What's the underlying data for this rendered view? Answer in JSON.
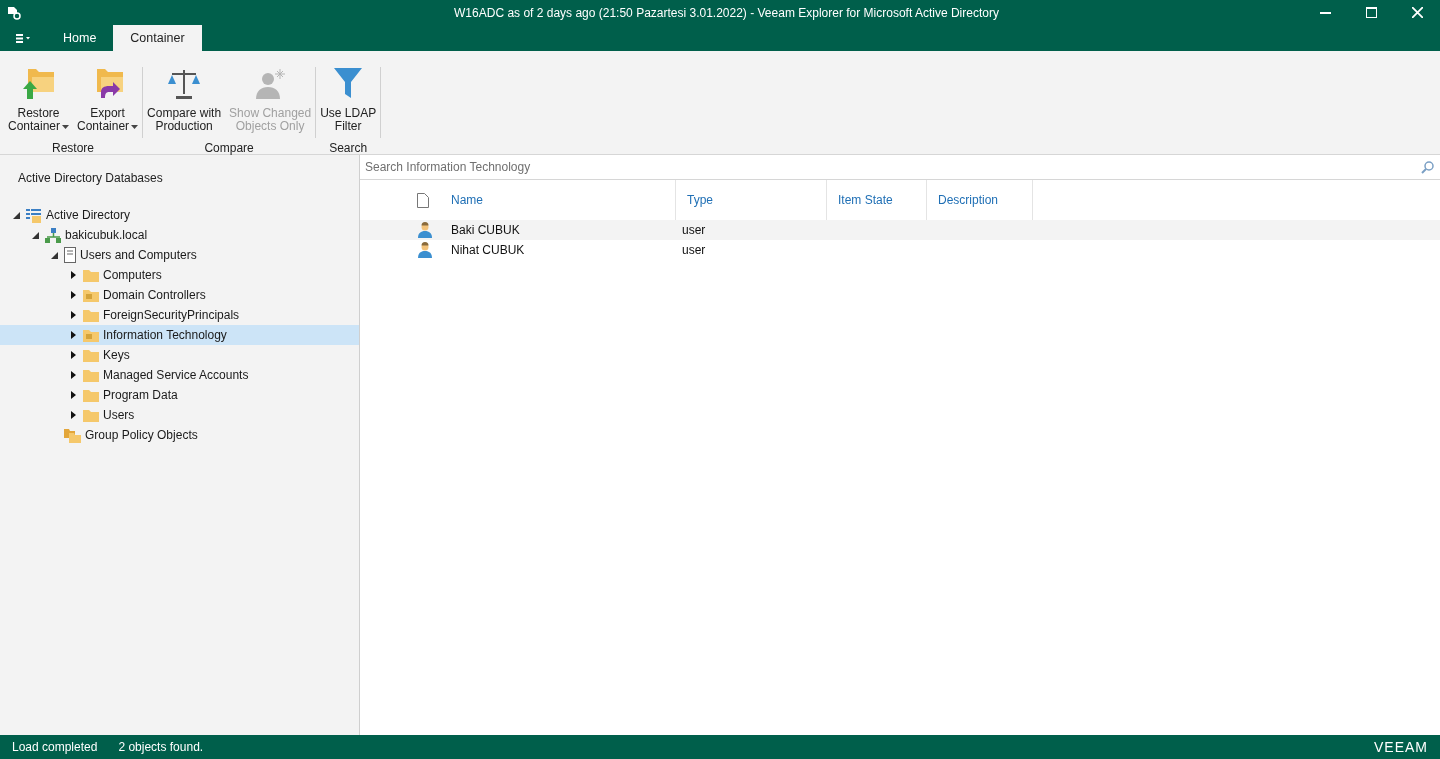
{
  "window": {
    "title": "W16ADC as of 2 days ago (21:50 Pazartesi 3.01.2022) - Veeam Explorer for Microsoft Active Directory"
  },
  "tabs": [
    {
      "label": "Home",
      "selected": false
    },
    {
      "label": "Container",
      "selected": true
    }
  ],
  "ribbon_groups": [
    {
      "label": "Restore",
      "buttons": [
        {
          "kind": "restore",
          "line1": "Restore",
          "line2": "Container",
          "dropdown": true,
          "disabled": false
        },
        {
          "kind": "export",
          "line1": "Export",
          "line2": "Container",
          "dropdown": true,
          "disabled": false
        }
      ]
    },
    {
      "label": "Compare",
      "buttons": [
        {
          "kind": "compare",
          "line1": "Compare with",
          "line2": "Production",
          "dropdown": false,
          "disabled": false
        },
        {
          "kind": "changed",
          "line1": "Show Changed",
          "line2": "Objects Only",
          "dropdown": false,
          "disabled": true
        }
      ]
    },
    {
      "label": "Search",
      "buttons": [
        {
          "kind": "filter",
          "line1": "Use LDAP",
          "line2": "Filter",
          "dropdown": false,
          "disabled": false
        }
      ]
    }
  ],
  "sidebar": {
    "title": "Active Directory Databases",
    "tree": [
      {
        "label": "Active Directory",
        "kind": "root",
        "has_children": true,
        "expanded": true,
        "selected": false,
        "children": [
          {
            "label": "bakicubuk.local",
            "kind": "domain",
            "has_children": true,
            "expanded": true,
            "selected": false,
            "children": [
              {
                "label": "Users and Computers",
                "kind": "server",
                "has_children": true,
                "expanded": true,
                "selected": false,
                "children": [
                  {
                    "label": "Computers",
                    "kind": "folder",
                    "has_children": true,
                    "expanded": false,
                    "selected": false
                  },
                  {
                    "label": "Domain Controllers",
                    "kind": "ou",
                    "has_children": true,
                    "expanded": false,
                    "selected": false
                  },
                  {
                    "label": "ForeignSecurityPrincipals",
                    "kind": "folder",
                    "has_children": true,
                    "expanded": false,
                    "selected": false
                  },
                  {
                    "label": "Information Technology",
                    "kind": "ou",
                    "has_children": true,
                    "expanded": false,
                    "selected": true
                  },
                  {
                    "label": "Keys",
                    "kind": "folder",
                    "has_children": true,
                    "expanded": false,
                    "selected": false
                  },
                  {
                    "label": "Managed Service Accounts",
                    "kind": "folder",
                    "has_children": true,
                    "expanded": false,
                    "selected": false
                  },
                  {
                    "label": "Program Data",
                    "kind": "folder",
                    "has_children": true,
                    "expanded": false,
                    "selected": false
                  },
                  {
                    "label": "Users",
                    "kind": "folder",
                    "has_children": true,
                    "expanded": false,
                    "selected": false
                  }
                ]
              },
              {
                "label": "Group Policy Objects",
                "kind": "gpo",
                "has_children": false,
                "selected": false
              }
            ]
          }
        ]
      }
    ]
  },
  "search": {
    "placeholder": "Search Information Technology"
  },
  "table": {
    "columns": [
      "Name",
      "Type",
      "Item State",
      "Description"
    ],
    "rows": [
      {
        "name": "Baki CUBUK",
        "type": "user",
        "selected": true
      },
      {
        "name": "Nihat CUBUK",
        "type": "user",
        "selected": false
      }
    ]
  },
  "status_bar": {
    "status": "Load completed",
    "count": "2 objects found.",
    "logo": "VEEAM"
  }
}
